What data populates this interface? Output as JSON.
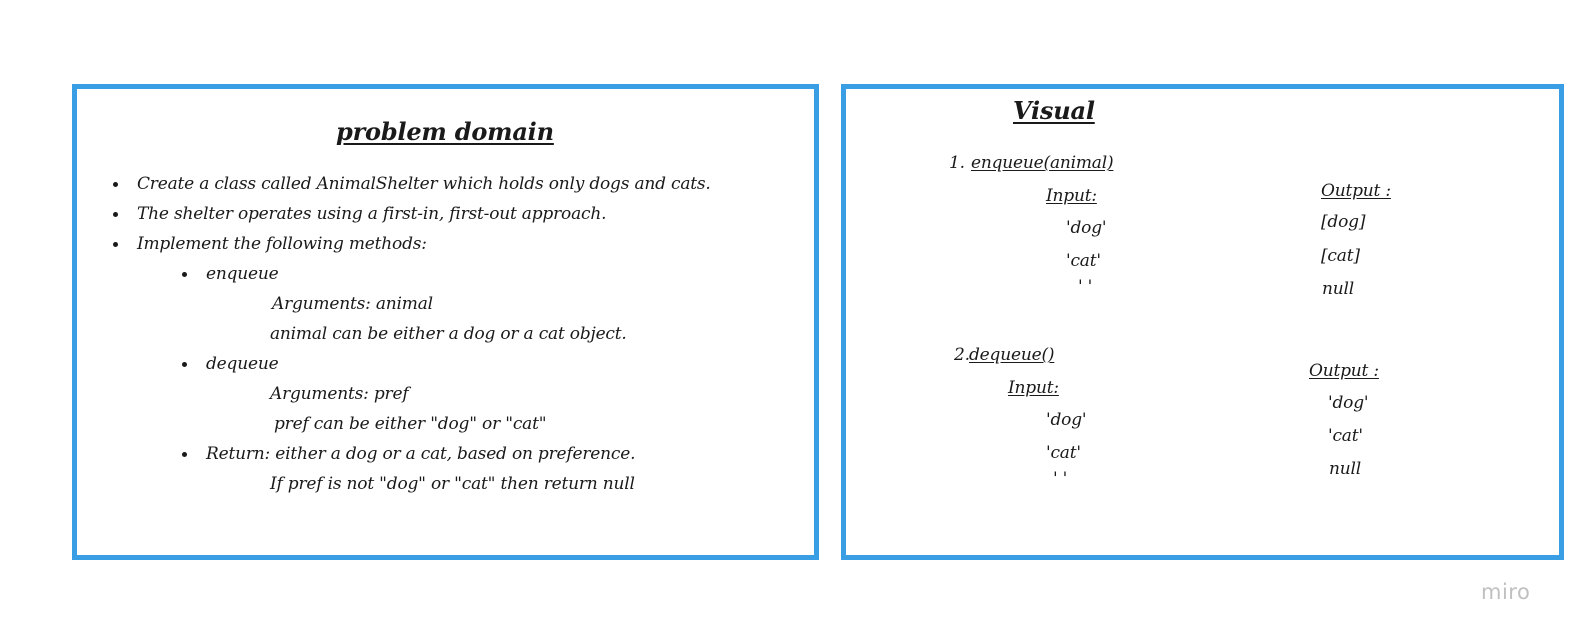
{
  "problem_domain": {
    "title": "problem domain",
    "bullets": [
      "Create a class called AnimalShelter which holds only dogs and cats.",
      "The shelter operates using a first-in, first-out approach.",
      "Implement the following methods:"
    ],
    "methods": [
      {
        "name": "enqueue",
        "lines": [
          "Arguments: animal",
          "animal can be either a dog or a cat object."
        ]
      },
      {
        "name": "dequeue",
        "lines": [
          "Arguments: pref",
          "pref can be either \"dog\" or \"cat\""
        ]
      },
      {
        "name": "Return: either a dog or a cat, based on preference.",
        "lines": [
          "If pref is not \"dog\" or \"cat\" then return null"
        ]
      }
    ]
  },
  "visual": {
    "title": "Visual",
    "sections": [
      {
        "number": "1.",
        "title": "enqueue(animal)",
        "input_label": "Input:",
        "inputs": [
          "'dog'",
          "'cat'",
          "' '"
        ],
        "output_label": "Output :",
        "outputs": [
          "[dog]",
          "[cat]",
          "null"
        ]
      },
      {
        "number": "2.",
        "title": "dequeue()",
        "input_label": "Input:",
        "inputs": [
          "'dog'",
          "'cat'",
          "' '"
        ],
        "output_label": "Output :",
        "outputs": [
          "'dog'",
          "'cat'",
          "null"
        ]
      }
    ]
  },
  "branding": {
    "logo": "miro"
  },
  "colors": {
    "frame_border": "#3a9ee4"
  }
}
